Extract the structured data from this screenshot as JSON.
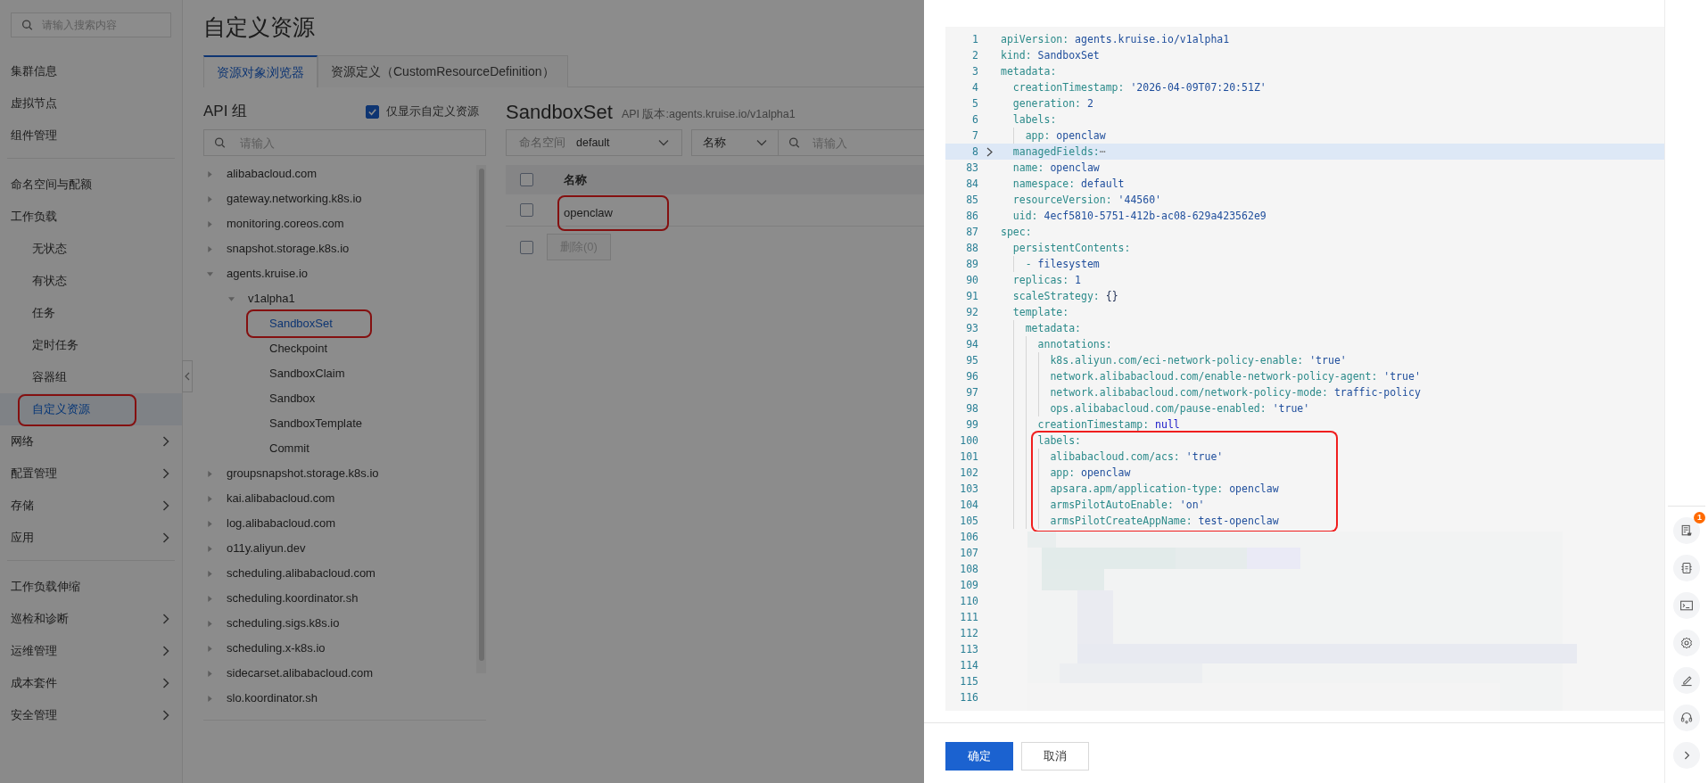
{
  "sidebar": {
    "search_placeholder": "请输入搜索内容",
    "sections": [
      [
        {
          "label": "集群信息",
          "expandable": false,
          "selected": false,
          "annotated": false
        },
        {
          "label": "虚拟节点",
          "expandable": false,
          "selected": false,
          "annotated": false
        },
        {
          "label": "组件管理",
          "expandable": false,
          "selected": false,
          "annotated": false
        }
      ],
      [
        {
          "label": "命名空间与配额",
          "expandable": false,
          "selected": false,
          "annotated": false
        },
        {
          "label": "工作负载",
          "expandable": false,
          "selected": false,
          "annotated": false,
          "children": [
            {
              "label": "无状态",
              "expandable": false,
              "selected": false,
              "annotated": false
            },
            {
              "label": "有状态",
              "expandable": false,
              "selected": false,
              "annotated": false
            },
            {
              "label": "任务",
              "expandable": false,
              "selected": false,
              "annotated": false
            },
            {
              "label": "定时任务",
              "expandable": false,
              "selected": false,
              "annotated": false
            },
            {
              "label": "容器组",
              "expandable": false,
              "selected": false,
              "annotated": false
            },
            {
              "label": "自定义资源",
              "expandable": false,
              "selected": true,
              "annotated": true
            }
          ]
        },
        {
          "label": "网络",
          "expandable": true,
          "selected": false,
          "annotated": false
        },
        {
          "label": "配置管理",
          "expandable": true,
          "selected": false,
          "annotated": false
        },
        {
          "label": "存储",
          "expandable": true,
          "selected": false,
          "annotated": false
        },
        {
          "label": "应用",
          "expandable": true,
          "selected": false,
          "annotated": false
        }
      ],
      [
        {
          "label": "工作负载伸缩",
          "expandable": false,
          "selected": false,
          "annotated": false
        },
        {
          "label": "巡检和诊断",
          "expandable": true,
          "selected": false,
          "annotated": false
        },
        {
          "label": "运维管理",
          "expandable": true,
          "selected": false,
          "annotated": false
        },
        {
          "label": "成本套件",
          "expandable": true,
          "selected": false,
          "annotated": false
        },
        {
          "label": "安全管理",
          "expandable": true,
          "selected": false,
          "annotated": false
        }
      ]
    ]
  },
  "page": {
    "title": "自定义资源",
    "tabs": [
      {
        "label": "资源对象浏览器",
        "selected": true
      },
      {
        "label": "资源定义（CustomResourceDefinition）",
        "selected": false
      }
    ]
  },
  "api_groups": {
    "title": "API 组",
    "filter": {
      "label": "仅显示自定义资源",
      "checked": true
    },
    "search_placeholder": "请输入",
    "tree": [
      {
        "label": "alibabacloud.com",
        "expanded": false,
        "selected": false,
        "annotated": false
      },
      {
        "label": "gateway.networking.k8s.io",
        "expanded": false,
        "selected": false,
        "annotated": false
      },
      {
        "label": "monitoring.coreos.com",
        "expanded": false,
        "selected": false,
        "annotated": false
      },
      {
        "label": "snapshot.storage.k8s.io",
        "expanded": false,
        "selected": false,
        "annotated": false
      },
      {
        "label": "agents.kruise.io",
        "expanded": true,
        "selected": false,
        "annotated": false,
        "children": [
          {
            "label": "v1alpha1",
            "expanded": true,
            "selected": false,
            "annotated": false,
            "children": [
              {
                "label": "SandboxSet",
                "selected": true,
                "annotated": true
              },
              {
                "label": "Checkpoint",
                "selected": false,
                "annotated": false
              },
              {
                "label": "SandboxClaim",
                "selected": false,
                "annotated": false
              },
              {
                "label": "Sandbox",
                "selected": false,
                "annotated": false
              },
              {
                "label": "SandboxTemplate",
                "selected": false,
                "annotated": false
              },
              {
                "label": "Commit",
                "selected": false,
                "annotated": false
              }
            ]
          }
        ]
      },
      {
        "label": "groupsnapshot.storage.k8s.io",
        "expanded": false,
        "selected": false,
        "annotated": false
      },
      {
        "label": "kai.alibabacloud.com",
        "expanded": false,
        "selected": false,
        "annotated": false
      },
      {
        "label": "log.alibabacloud.com",
        "expanded": false,
        "selected": false,
        "annotated": false
      },
      {
        "label": "o11y.aliyun.dev",
        "expanded": false,
        "selected": false,
        "annotated": false
      },
      {
        "label": "scheduling.alibabacloud.com",
        "expanded": false,
        "selected": false,
        "annotated": false
      },
      {
        "label": "scheduling.koordinator.sh",
        "expanded": false,
        "selected": false,
        "annotated": false
      },
      {
        "label": "scheduling.sigs.k8s.io",
        "expanded": false,
        "selected": false,
        "annotated": false
      },
      {
        "label": "scheduling.x-k8s.io",
        "expanded": false,
        "selected": false,
        "annotated": false
      },
      {
        "label": "sidecarset.alibabacloud.com",
        "expanded": false,
        "selected": false,
        "annotated": false
      },
      {
        "label": "slo.koordinator.sh",
        "expanded": false,
        "selected": false,
        "annotated": false
      }
    ]
  },
  "resource": {
    "title": "SandboxSet",
    "api_version": "API 版本:agents.kruise.io/v1alpha1",
    "namespace": {
      "label": "命名空间",
      "value": "default"
    },
    "field_select": "名称",
    "search_placeholder": "请输入",
    "header_checkbox": {
      "checked": false
    },
    "columns": [
      "名称"
    ],
    "rows": [
      {
        "name": "openclaw",
        "checked": false,
        "annotated": true
      }
    ],
    "footer_checkbox": {
      "checked": false
    },
    "delete_button": {
      "label": "删除(0)",
      "disabled": true
    }
  },
  "editor": {
    "lines": [
      {
        "no": "1",
        "key": "apiVersion:",
        "value": "agents.kruise.io/v1alpha1",
        "kind": "plain",
        "folded": false,
        "annotated": false
      },
      {
        "no": "2",
        "key": "kind:",
        "value": "SandboxSet",
        "kind": "plain",
        "folded": false,
        "annotated": false
      },
      {
        "no": "3",
        "key": "metadata:",
        "folded": false,
        "annotated": false
      },
      {
        "no": "4",
        "key": "  creationTimestamp:",
        "value": "'2026-04-09T07:20:51Z'",
        "kind": "plain",
        "folded": false,
        "annotated": false
      },
      {
        "no": "5",
        "key": "  generation:",
        "value": "2",
        "kind": "plain",
        "folded": false,
        "annotated": false
      },
      {
        "no": "6",
        "key": "  labels:",
        "folded": false,
        "annotated": false
      },
      {
        "no": "7",
        "key": "    app:",
        "value": "openclaw",
        "kind": "plain",
        "folded": false,
        "annotated": false
      },
      {
        "no": "8",
        "key": "  managedFields:",
        "fold_marker": "⋯",
        "folded": true,
        "annotated": false
      },
      {
        "no": "83",
        "key": "  name:",
        "value": "openclaw",
        "kind": "plain",
        "folded": false,
        "annotated": false
      },
      {
        "no": "84",
        "key": "  namespace:",
        "value": "default",
        "kind": "plain",
        "folded": false,
        "annotated": false
      },
      {
        "no": "85",
        "key": "  resourceVersion:",
        "value": "'44560'",
        "kind": "plain",
        "folded": false,
        "annotated": false
      },
      {
        "no": "86",
        "key": "  uid:",
        "value": "4ecf5810-5751-412b-ac08-629a423562e9",
        "kind": "plain",
        "folded": false,
        "annotated": false
      },
      {
        "no": "87",
        "key": "spec:",
        "folded": false,
        "annotated": false
      },
      {
        "no": "88",
        "key": "  persistentContents:",
        "folded": false,
        "annotated": false
      },
      {
        "no": "89",
        "key": "    -",
        "value": "filesystem",
        "kind": "plain",
        "folded": false,
        "annotated": false
      },
      {
        "no": "90",
        "key": "  replicas:",
        "value": "1",
        "kind": "plain",
        "folded": false,
        "annotated": false
      },
      {
        "no": "91",
        "key": "  scaleStrategy:",
        "value": "{}",
        "kind": "brace",
        "folded": false,
        "annotated": false
      },
      {
        "no": "92",
        "key": "  template:",
        "folded": false,
        "annotated": false
      },
      {
        "no": "93",
        "key": "    metadata:",
        "folded": false,
        "annotated": false
      },
      {
        "no": "94",
        "key": "      annotations:",
        "folded": false,
        "annotated": false
      },
      {
        "no": "95",
        "key": "        k8s.aliyun.com/eci-network-policy-enable:",
        "value": "'true'",
        "kind": "plain",
        "folded": false,
        "annotated": false
      },
      {
        "no": "96",
        "key": "        network.alibabacloud.com/enable-network-policy-agent:",
        "value": "'true'",
        "kind": "plain",
        "folded": false,
        "annotated": false
      },
      {
        "no": "97",
        "key": "        network.alibabacloud.com/network-policy-mode:",
        "value": "traffic-policy",
        "kind": "plain",
        "folded": false,
        "annotated": false
      },
      {
        "no": "98",
        "key": "        ops.alibabacloud.com/pause-enabled:",
        "value": "'true'",
        "kind": "plain",
        "folded": false,
        "annotated": false
      },
      {
        "no": "99",
        "key": "      creationTimestamp:",
        "value": "null",
        "kind": "null",
        "folded": false,
        "annotated": false
      },
      {
        "no": "100",
        "key": "      labels:",
        "folded": false,
        "annotated": true
      },
      {
        "no": "101",
        "key": "        alibabacloud.com/acs:",
        "value": "'true'",
        "kind": "plain",
        "folded": false,
        "annotated": true
      },
      {
        "no": "102",
        "key": "        app:",
        "value": "openclaw",
        "kind": "plain",
        "folded": false,
        "annotated": true
      },
      {
        "no": "103",
        "key": "        apsara.apm/application-type:",
        "value": "openclaw",
        "kind": "plain",
        "folded": false,
        "annotated": true
      },
      {
        "no": "104",
        "key": "        armsPilotAutoEnable:",
        "value": "'on'",
        "kind": "plain",
        "folded": false,
        "annotated": true
      },
      {
        "no": "105",
        "key": "        armsPilotCreateAppName:",
        "value": "test-openclaw",
        "kind": "plain",
        "folded": false,
        "annotated": true
      },
      {
        "no": "106"
      },
      {
        "no": "107"
      },
      {
        "no": "108"
      },
      {
        "no": "109"
      },
      {
        "no": "110"
      },
      {
        "no": "111"
      },
      {
        "no": "112"
      },
      {
        "no": "113"
      },
      {
        "no": "114"
      },
      {
        "no": "115"
      },
      {
        "no": "116"
      }
    ]
  },
  "footer": {
    "buttons": [
      {
        "label": "确定",
        "kind": "primary"
      },
      {
        "label": "取消",
        "kind": "secondary"
      }
    ]
  },
  "side_toolbar": {
    "badge": "1"
  }
}
